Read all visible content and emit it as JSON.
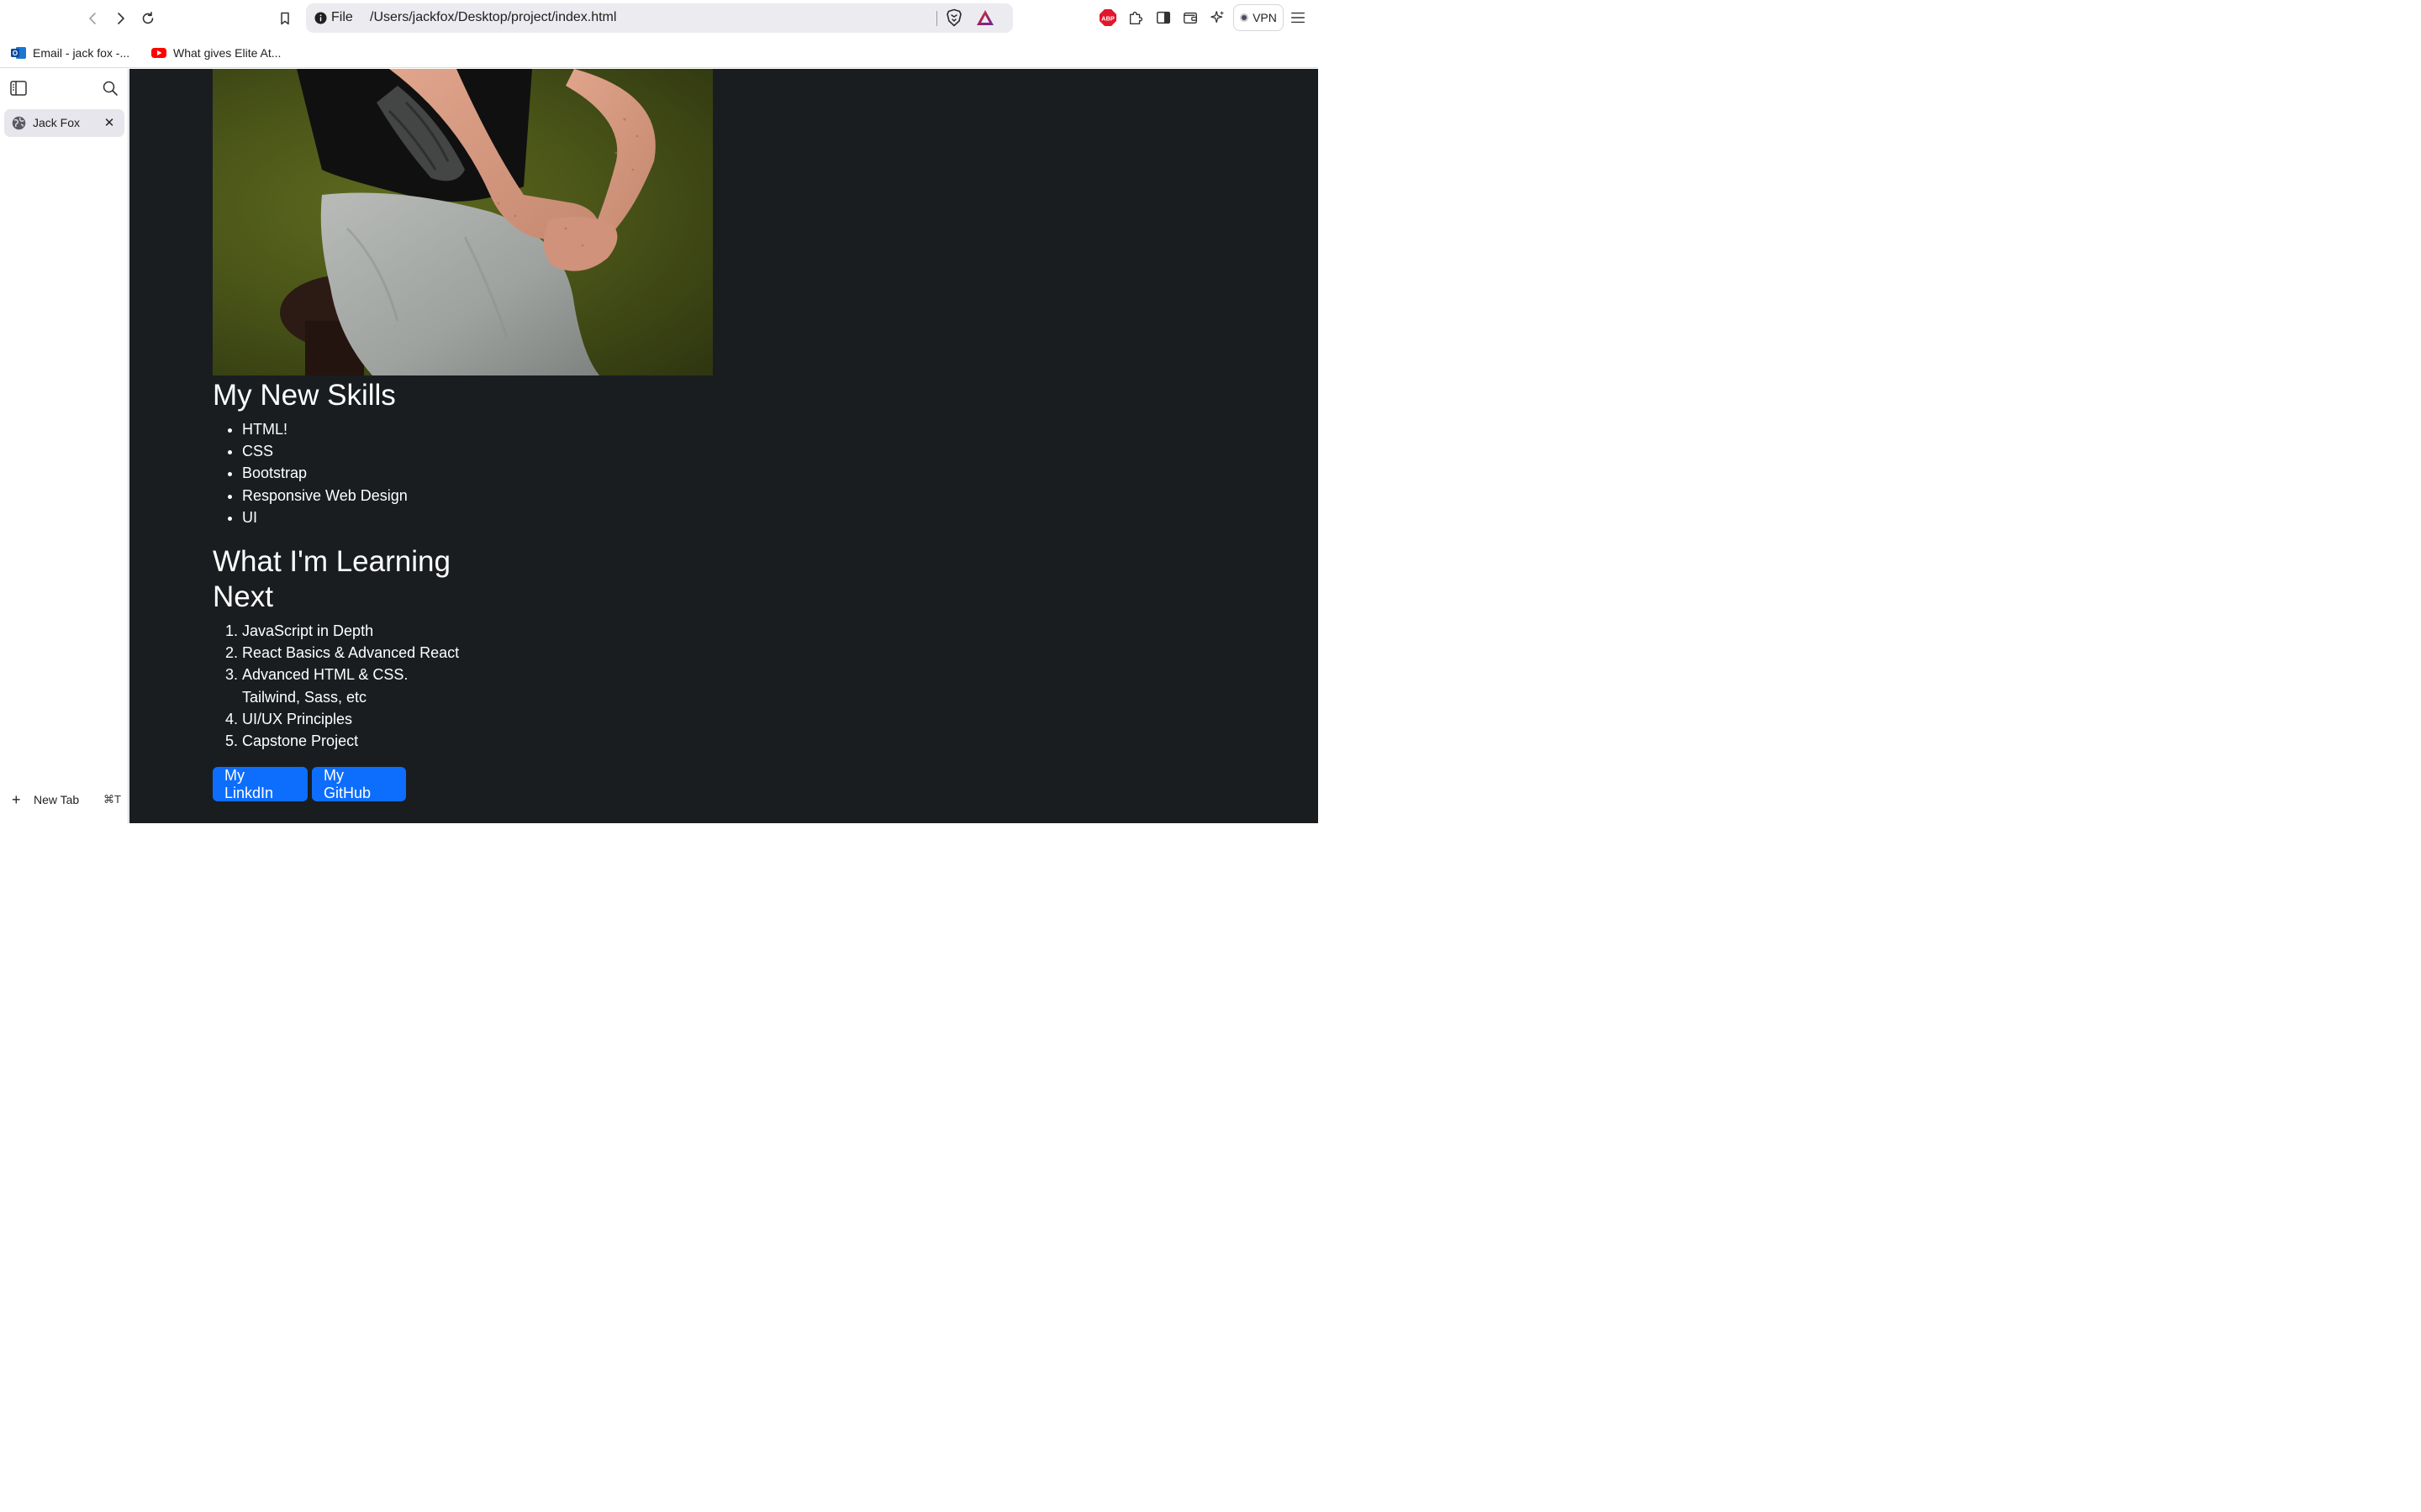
{
  "browser": {
    "address": {
      "scheme_label": "File",
      "url": "/Users/jackfox/Desktop/project/index.html"
    },
    "vpn_label": "VPN",
    "extensions": [
      "adblock-icon",
      "puzzle-icon",
      "sidebar-icon",
      "wallet-icon",
      "leo-ai-icon"
    ]
  },
  "bookmarks": [
    {
      "label": "Email - jack fox -...",
      "icon": "outlook-icon"
    },
    {
      "label": "What gives Elite At...",
      "icon": "youtube-icon"
    }
  ],
  "sidebar": {
    "tabs": [
      {
        "title": "Jack Fox",
        "icon": "globe-icon"
      }
    ],
    "new_tab_label": "New Tab",
    "new_tab_shortcut": "⌘T"
  },
  "page": {
    "skills_heading": "My New Skills",
    "skills": [
      "HTML!",
      "CSS",
      "Bootstrap",
      "Responsive Web Design",
      "UI"
    ],
    "learning_heading": "What I'm Learning Next",
    "learning": [
      "JavaScript in Depth",
      "React Basics & Advanced React",
      "Advanced HTML & CSS. Tailwind, Sass, etc",
      "UI/UX Principles",
      "Capstone Project"
    ],
    "buttons": {
      "linkedin": "My LinkdIn",
      "github": "My GitHub"
    }
  },
  "colors": {
    "page_background": "#1a1d20",
    "button_primary": "#0d6efd",
    "text_on_dark": "#ffffff"
  }
}
